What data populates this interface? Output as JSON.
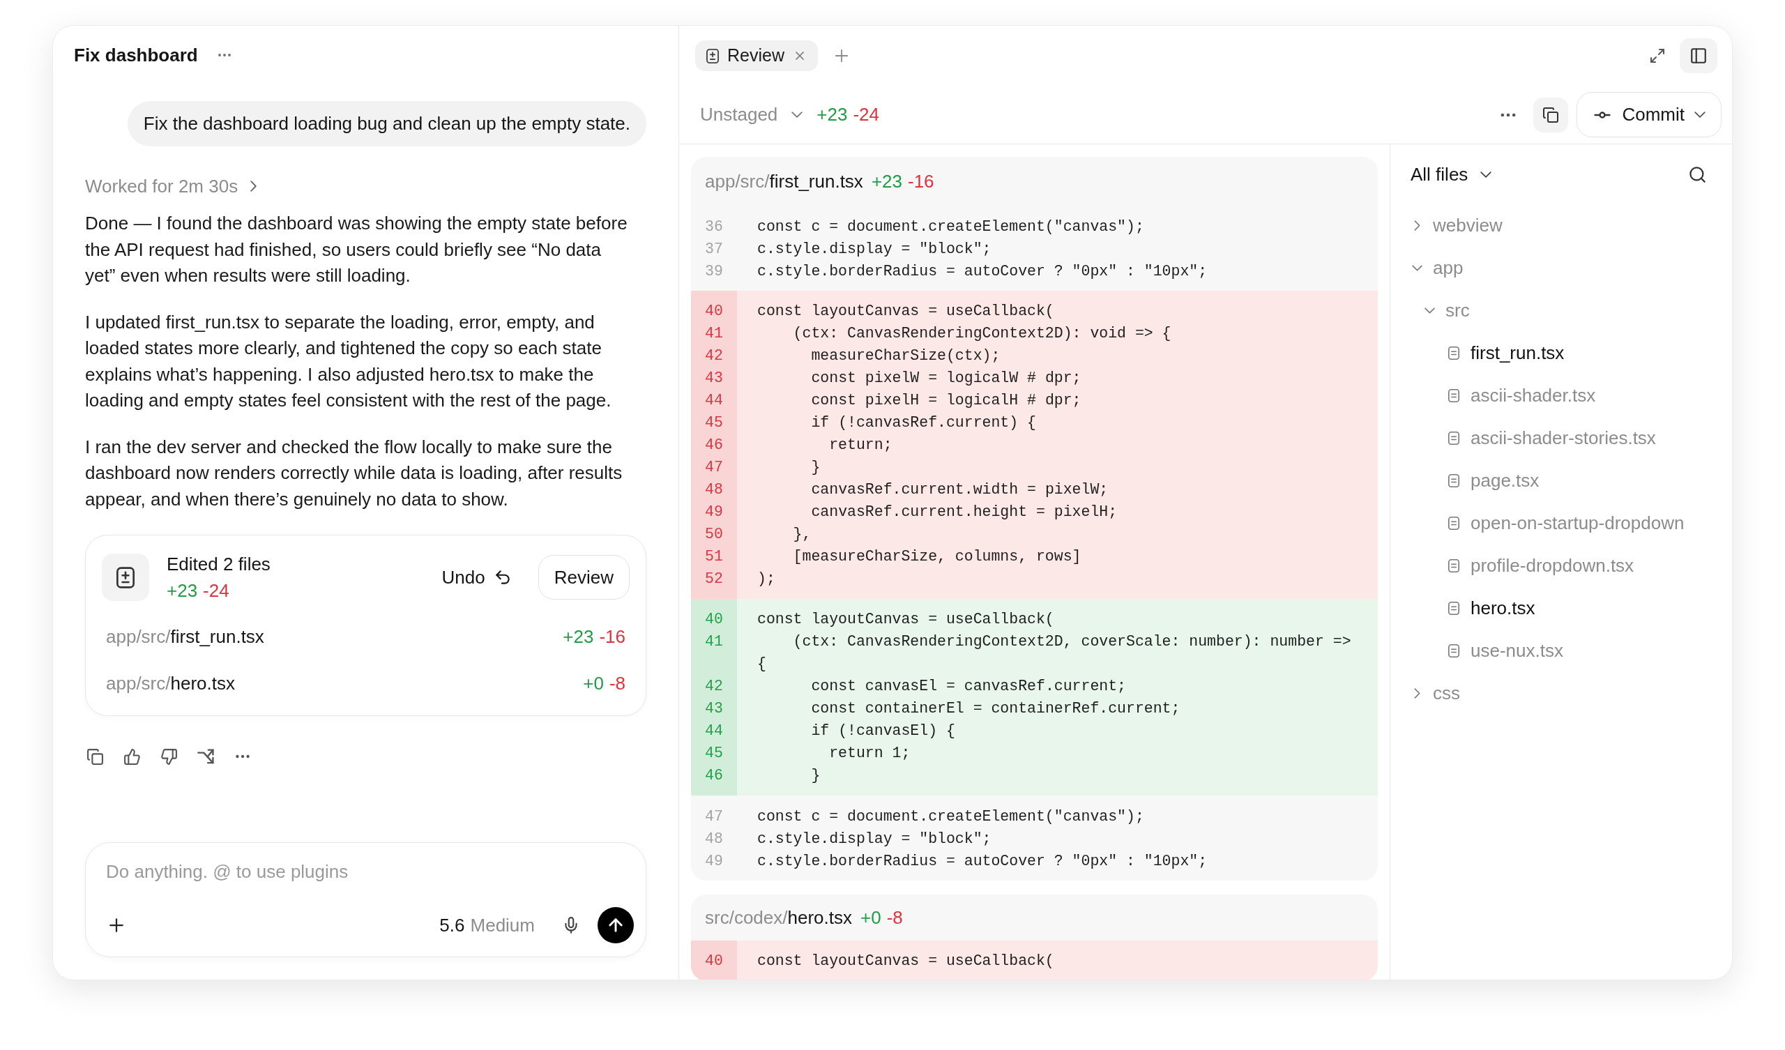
{
  "chat": {
    "title": "Fix dashboard",
    "user_message": "Fix the dashboard loading bug and clean up the empty state.",
    "worked_for": "Worked for 2m 30s",
    "paragraphs": [
      "Done — I found the dashboard was showing the empty state before the API request had finished, so users could briefly see “No data yet” even when results were still loading.",
      "I updated first_run.tsx to separate the loading, error, empty, and loaded states more clearly, and tightened the copy so each state explains what’s happening. I also adjusted hero.tsx to make the loading and empty states feel consistent with the rest of the page.",
      "I ran the dev server and checked the flow locally to make sure the dashboard now renders correctly while data is loading, after results appear, and when there’s genuinely no data to show."
    ],
    "edits": {
      "title": "Edited 2 files",
      "added": "+23",
      "removed": "-24",
      "undo": "Undo",
      "review": "Review",
      "files": [
        {
          "dir": "app/src/",
          "name": "first_run.tsx",
          "added": "+23",
          "removed": "-16"
        },
        {
          "dir": "app/src/",
          "name": "hero.tsx",
          "added": "+0",
          "removed": "-8"
        }
      ]
    },
    "composer": {
      "placeholder": "Do anything. @ to use plugins",
      "model": "5.6",
      "effort": "Medium"
    }
  },
  "review": {
    "tabs": [
      {
        "label": "Review",
        "selected": true
      }
    ],
    "changes": {
      "filter": "Unstaged",
      "added": "+23",
      "removed": "-24"
    },
    "commit": "Commit",
    "diffs": [
      {
        "dir": "app/src/",
        "name": "first_run.tsx",
        "added": "+23",
        "removed": "-16",
        "lines": [
          {
            "kind": "context",
            "number": "36",
            "code": "const c = document.createElement(\"canvas\");"
          },
          {
            "kind": "context",
            "number": "37",
            "code": "c.style.display = \"block\";"
          },
          {
            "kind": "context",
            "number": "39",
            "code": "c.style.borderRadius = autoCover ? \"0px\" : \"10px\";"
          },
          {
            "kind": "removed",
            "number": "40",
            "code": "const layoutCanvas = useCallback("
          },
          {
            "kind": "removed",
            "number": "41",
            "code": "    (ctx: CanvasRenderingContext2D): void => {"
          },
          {
            "kind": "removed",
            "number": "42",
            "code": "      measureCharSize(ctx);"
          },
          {
            "kind": "removed",
            "number": "43",
            "code": "      const pixelW = logicalW # dpr;"
          },
          {
            "kind": "removed",
            "number": "44",
            "code": "      const pixelH = logicalH # dpr;"
          },
          {
            "kind": "removed",
            "number": "45",
            "code": "      if (!canvasRef.current) {"
          },
          {
            "kind": "removed",
            "number": "46",
            "code": "        return;"
          },
          {
            "kind": "removed",
            "number": "47",
            "code": "      }"
          },
          {
            "kind": "removed",
            "number": "48",
            "code": "      canvasRef.current.width = pixelW;"
          },
          {
            "kind": "removed",
            "number": "49",
            "code": "      canvasRef.current.height = pixelH;"
          },
          {
            "kind": "removed",
            "number": "50",
            "code": "    },"
          },
          {
            "kind": "removed",
            "number": "51",
            "code": "    [measureCharSize, columns, rows]"
          },
          {
            "kind": "removed",
            "number": "52",
            "code": ");"
          },
          {
            "kind": "added",
            "number": "40",
            "code": "const layoutCanvas = useCallback("
          },
          {
            "kind": "added",
            "number": "41",
            "code": "    (ctx: CanvasRenderingContext2D, coverScale: number): number => {"
          },
          {
            "kind": "added",
            "number": "42",
            "code": "      const canvasEl = canvasRef.current;"
          },
          {
            "kind": "added",
            "number": "43",
            "code": "      const containerEl = containerRef.current;"
          },
          {
            "kind": "added",
            "number": "44",
            "code": "      if (!canvasEl) {"
          },
          {
            "kind": "added",
            "number": "45",
            "code": "        return 1;"
          },
          {
            "kind": "added",
            "number": "46",
            "code": "      }"
          },
          {
            "kind": "context",
            "number": "47",
            "code": "const c = document.createElement(\"canvas\");"
          },
          {
            "kind": "context",
            "number": "48",
            "code": "c.style.display = \"block\";"
          },
          {
            "kind": "context",
            "number": "49",
            "code": "c.style.borderRadius = autoCover ? \"0px\" : \"10px\";"
          }
        ]
      },
      {
        "dir": "src/codex/",
        "name": "hero.tsx",
        "added": "+0",
        "removed": "-8",
        "lines": [
          {
            "kind": "removed",
            "number": "40",
            "code": "const layoutCanvas = useCallback("
          }
        ]
      }
    ],
    "file_tree": {
      "filter": "All files",
      "items": [
        {
          "kind": "folder",
          "name": "webview",
          "expanded": false
        },
        {
          "kind": "folder",
          "name": "app",
          "expanded": true,
          "children": [
            {
              "kind": "folder",
              "name": "src",
              "expanded": true,
              "children": [
                {
                  "kind": "file",
                  "name": "first_run.tsx",
                  "changed": true
                },
                {
                  "kind": "file",
                  "name": "ascii-shader.tsx",
                  "changed": false
                },
                {
                  "kind": "file",
                  "name": "ascii-shader-stories.tsx",
                  "changed": false
                },
                {
                  "kind": "file",
                  "name": "page.tsx",
                  "changed": false
                },
                {
                  "kind": "file",
                  "name": "open-on-startup-dropdown",
                  "changed": false
                },
                {
                  "kind": "file",
                  "name": "profile-dropdown.tsx",
                  "changed": false
                },
                {
                  "kind": "file",
                  "name": "hero.tsx",
                  "changed": true
                },
                {
                  "kind": "file",
                  "name": "use-nux.tsx",
                  "changed": false
                }
              ]
            }
          ]
        },
        {
          "kind": "folder",
          "name": "css",
          "expanded": false
        }
      ]
    }
  }
}
